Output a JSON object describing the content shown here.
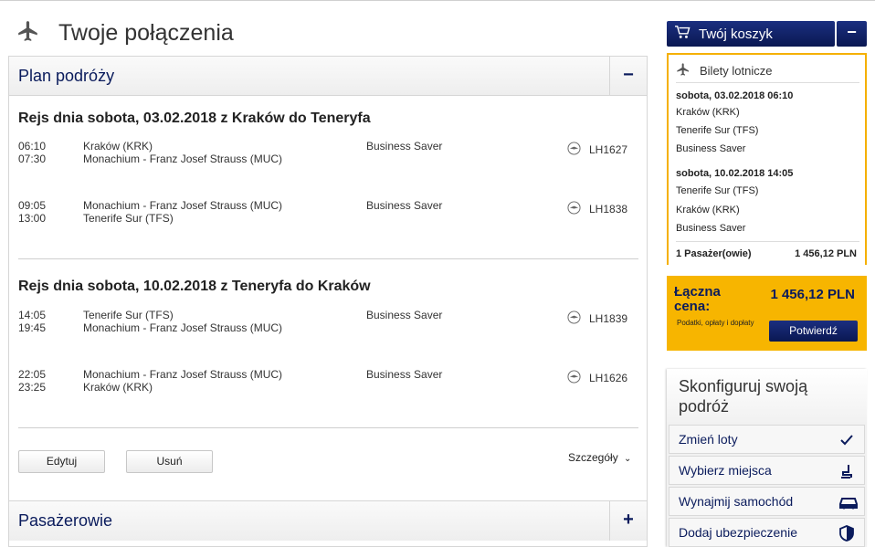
{
  "page": {
    "title": "Twoje połączenia",
    "icon": "airplane-icon"
  },
  "plan": {
    "title": "Plan podróży",
    "toggle": "−",
    "outbound": {
      "title": "Rejs dnia sobota, 03.02.2018 z Kraków do Teneryfa",
      "segments": [
        {
          "dep_time": "06:10",
          "arr_time": "07:30",
          "from": "Kraków (KRK)",
          "to": "Monachium - Franz Josef Strauss (MUC)",
          "fare": "Business Saver",
          "flight": "LH1627"
        },
        {
          "dep_time": "09:05",
          "arr_time": "13:00",
          "from": "Monachium - Franz Josef Strauss (MUC)",
          "to": "Tenerife Sur (TFS)",
          "fare": "Business Saver",
          "flight": "LH1838"
        }
      ]
    },
    "inbound": {
      "title": "Rejs dnia sobota, 10.02.2018 z Teneryfa do Kraków",
      "segments": [
        {
          "dep_time": "14:05",
          "arr_time": "19:45",
          "from": "Tenerife Sur (TFS)",
          "to": "Monachium - Franz Josef Strauss (MUC)",
          "fare": "Business Saver",
          "flight": "LH1839"
        },
        {
          "dep_time": "22:05",
          "arr_time": "23:25",
          "from": "Monachium - Franz Josef Strauss (MUC)",
          "to": "Kraków (KRK)",
          "fare": "Business Saver",
          "flight": "LH1626"
        }
      ]
    },
    "edit_label": "Edytuj",
    "remove_label": "Usuń",
    "details_label": "Szczegóły"
  },
  "passengers": {
    "title": "Pasażerowie",
    "toggle": "+"
  },
  "cart": {
    "button_label": "Twój koszyk",
    "collapse": "−",
    "tickets_label": "Bilety lotnicze",
    "outbound": {
      "date": "sobota, 03.02.2018 06:10",
      "from": "Kraków (KRK)",
      "to": "Tenerife Sur (TFS)",
      "fare": "Business Saver"
    },
    "inbound": {
      "date": "sobota, 10.02.2018 14:05",
      "from": "Tenerife Sur (TFS)",
      "to": "Kraków (KRK)",
      "fare": "Business Saver"
    },
    "passengers_label": "1 Pasażer(owie)",
    "price": "1 456,12 PLN"
  },
  "total": {
    "label": "Łączna cena:",
    "value": "1 456,12 PLN",
    "note": "Podatki, opłaty i dopłaty",
    "confirm_label": "Potwierdź"
  },
  "configure": {
    "title": "Skonfiguruj swoją podróż",
    "items": [
      {
        "label": "Zmień loty",
        "icon": "checkmark-icon"
      },
      {
        "label": "Wybierz miejsca",
        "icon": "seat-icon"
      },
      {
        "label": "Wynajmij samochód",
        "icon": "car-icon"
      },
      {
        "label": "Dodaj ubezpieczenie",
        "icon": "shield-icon"
      }
    ]
  },
  "colors": {
    "navy": "#0a1b5c",
    "yellow": "#f7b500",
    "border": "#d6d6d6"
  }
}
